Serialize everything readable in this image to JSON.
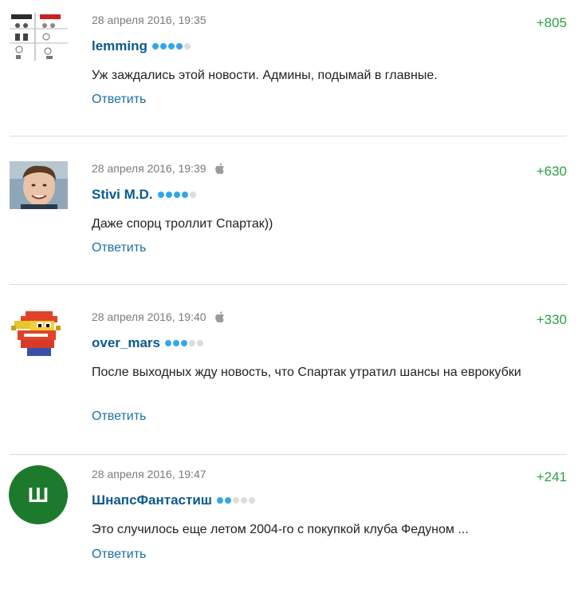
{
  "comments": [
    {
      "date": "28 апреля 2016, 19:35",
      "rating": "+805",
      "author": "lemming",
      "level": 4,
      "text": "Уж заждались этой новости. Админы, подымай в главные.",
      "reply_label": "Ответить",
      "apple": false,
      "avatar": "comic-grid-avatar"
    },
    {
      "date": "28 апреля 2016, 19:39",
      "rating": "+630",
      "author": "Stivi M.D.",
      "level": 4,
      "text": "Даже спорц троллит Спартак))",
      "reply_label": "Ответить",
      "apple": true,
      "avatar": "photo-avatar"
    },
    {
      "date": "28 апреля 2016, 19:40",
      "rating": "+330",
      "author": "over_mars",
      "level": 3,
      "text": "После выходных жду новость, что Спартак утратил шансы на еврокубки",
      "reply_label": "Ответить",
      "apple": true,
      "avatar": "pixel-character-avatar"
    },
    {
      "date": "28 апреля 2016, 19:47",
      "rating": "+241",
      "author": "ШнапсФантастиш",
      "level": 2,
      "text": "Это случилось еще летом 2004-го с покупкой клуба Федуном ...",
      "reply_label": "Ответить",
      "apple": false,
      "avatar": "letter-avatar",
      "avatar_letter": "Ш"
    }
  ],
  "colors": {
    "rating": "#2aa148",
    "author": "#0b5a8d",
    "reply": "#1c6fa3",
    "level_on": "#33a6e6",
    "level_off": "#dcdcdc",
    "letter_avatar_bg": "#1d7a2c"
  }
}
